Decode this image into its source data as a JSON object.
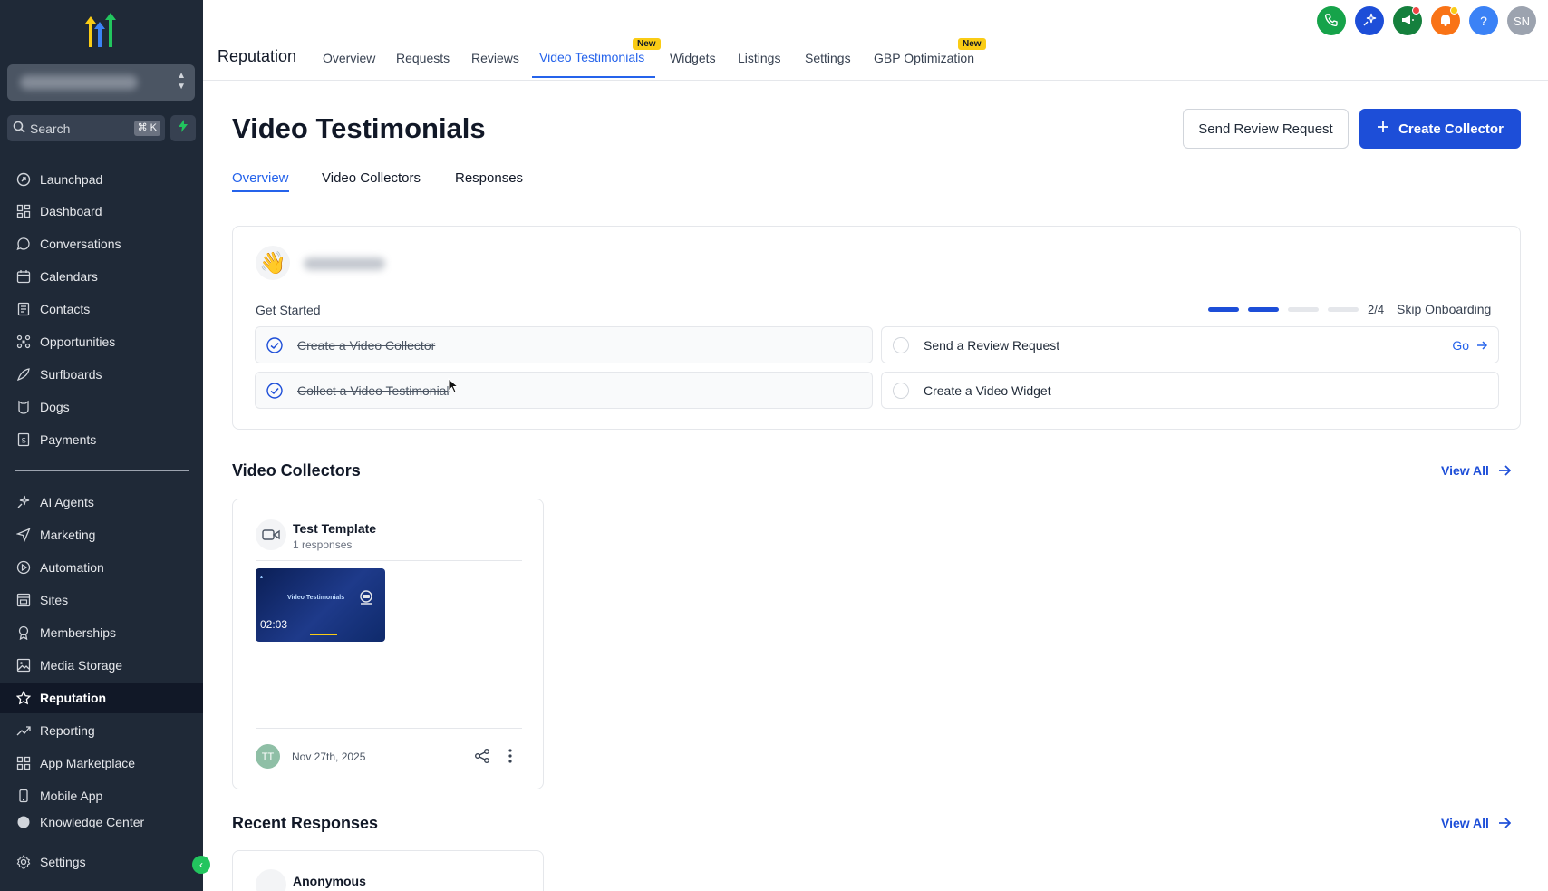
{
  "sidebar": {
    "search_label": "Search",
    "search_shortcut": "⌘ K",
    "items": [
      {
        "label": "Launchpad",
        "icon": "launchpad-icon"
      },
      {
        "label": "Dashboard",
        "icon": "dashboard-icon"
      },
      {
        "label": "Conversations",
        "icon": "chat-icon"
      },
      {
        "label": "Calendars",
        "icon": "calendar-icon"
      },
      {
        "label": "Contacts",
        "icon": "contacts-icon"
      },
      {
        "label": "Opportunities",
        "icon": "opportunities-icon"
      },
      {
        "label": "Surfboards",
        "icon": "surfboard-icon"
      },
      {
        "label": "Dogs",
        "icon": "dog-icon"
      },
      {
        "label": "Payments",
        "icon": "payments-icon"
      },
      {
        "label": "AI Agents",
        "icon": "sparkle-icon"
      },
      {
        "label": "Marketing",
        "icon": "send-icon"
      },
      {
        "label": "Automation",
        "icon": "automation-icon"
      },
      {
        "label": "Sites",
        "icon": "sites-icon"
      },
      {
        "label": "Memberships",
        "icon": "award-icon"
      },
      {
        "label": "Media Storage",
        "icon": "image-icon"
      },
      {
        "label": "Reputation",
        "icon": "star-icon"
      },
      {
        "label": "Reporting",
        "icon": "trend-icon"
      },
      {
        "label": "App Marketplace",
        "icon": "grid-icon"
      },
      {
        "label": "Mobile App",
        "icon": "mobile-icon"
      },
      {
        "label": "Knowledge Center",
        "icon": "book-icon"
      }
    ],
    "settings_label": "Settings",
    "active_item": "Reputation"
  },
  "topbar": {
    "title": "Reputation",
    "tabs": [
      "Overview",
      "Requests",
      "Reviews",
      "Video Testimonials",
      "Widgets",
      "Listings",
      "Settings",
      "GBP Optimization"
    ],
    "active_tab": "Video Testimonials",
    "new_badge": "New",
    "avatar_initials": "SN",
    "help_label": "?"
  },
  "page": {
    "title": "Video Testimonials",
    "send_review_request": "Send Review Request",
    "create_collector": "Create Collector",
    "subtabs": [
      "Overview",
      "Video Collectors",
      "Responses"
    ],
    "active_subtab": "Overview"
  },
  "onboarding": {
    "get_started": "Get Started",
    "progress": "2/4",
    "progress_done": 2,
    "progress_total": 4,
    "skip": "Skip Onboarding",
    "tasks": [
      {
        "label": "Create a Video Collector",
        "done": true
      },
      {
        "label": "Send a Review Request",
        "done": false,
        "action": "Go"
      },
      {
        "label": "Collect a Video Testimonial",
        "done": true
      },
      {
        "label": "Create a Video Widget",
        "done": false
      }
    ]
  },
  "video_collectors": {
    "title": "Video Collectors",
    "view_all": "View All",
    "cards": [
      {
        "name": "Test Template",
        "responses": "1 responses",
        "thumbnail_title": "Video Testimonials",
        "duration": "02:03",
        "avatar": "TT",
        "date": "Nov 27th, 2025"
      }
    ]
  },
  "recent_responses": {
    "title": "Recent Responses",
    "view_all": "View All",
    "items": [
      {
        "name": "Anonymous"
      }
    ]
  },
  "colors": {
    "accent": "#1d4ed8",
    "sidebar_bg": "#1f2937",
    "new_badge": "#facc15"
  }
}
